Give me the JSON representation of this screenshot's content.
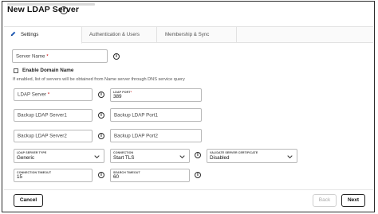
{
  "header": {
    "title": "New LDAP Server",
    "info_glyph": "i"
  },
  "tabs": [
    {
      "label": "Settings",
      "icon": "pencil-icon",
      "active": true
    },
    {
      "label": "Authentication & Users",
      "active": false
    },
    {
      "label": "Membership & Sync",
      "active": false
    }
  ],
  "form": {
    "server_name": {
      "placeholder": "Server Name",
      "required_mark": "*"
    },
    "enable_domain_name": {
      "label": "Enable Domain Name",
      "checked": false,
      "hint": "If enabled, list of servers will be obtained from Name server through DNS service query"
    },
    "ldap_server": {
      "placeholder": "LDAP Server",
      "required_mark": "*"
    },
    "ldap_port": {
      "label": "LDAP PORT",
      "required_mark": "*",
      "value": "389"
    },
    "backup_ldap_server1": {
      "placeholder": "Backup LDAP Server1"
    },
    "backup_ldap_port1": {
      "placeholder": "Backup LDAP Port1"
    },
    "backup_ldap_server2": {
      "placeholder": "Backup LDAP Server2"
    },
    "backup_ldap_port2": {
      "placeholder": "Backup LDAP Port2"
    },
    "ldap_server_type": {
      "label": "LDAP SERVER TYPE",
      "value": "Generic"
    },
    "connection": {
      "label": "CONNECTION",
      "value": "Start TLS"
    },
    "validate_server_certificate": {
      "label": "VALIDATE SERVER CERTIFICATE",
      "value": "Disabled"
    },
    "connection_timeout": {
      "label": "CONNECTION TIMEOUT",
      "value": "15"
    },
    "search_timeout": {
      "label": "SEARCH TIMEOUT",
      "value": "60"
    }
  },
  "info_glyph": "i",
  "footer": {
    "cancel_label": "Cancel",
    "back_label": "Back",
    "next_label": "Next"
  },
  "colors": {
    "border": "#b9b9b9",
    "required": "#cc0000",
    "disabled_text": "#aaaaaa"
  }
}
